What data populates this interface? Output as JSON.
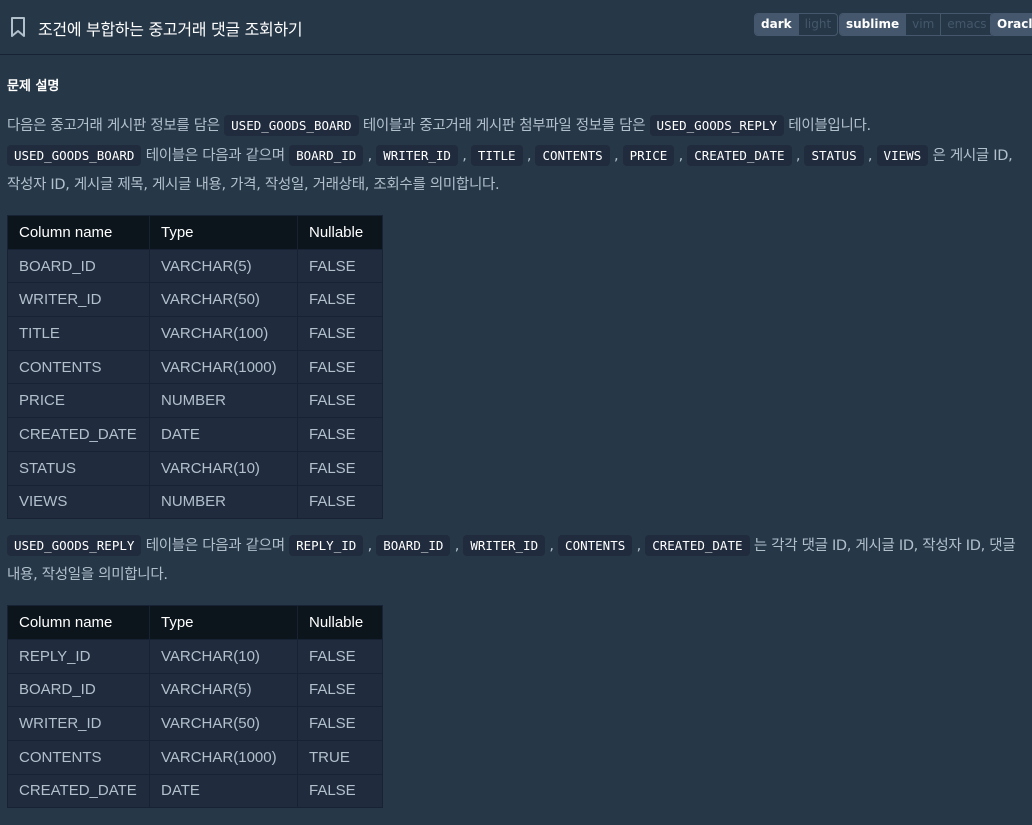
{
  "header": {
    "title": "조건에 부합하는 중고거래 댓글 조회하기",
    "theme_options": [
      "dark",
      "light"
    ],
    "theme_selected": "dark",
    "keymap_options": [
      "sublime",
      "vim",
      "emacs"
    ],
    "keymap_selected": "sublime",
    "language_selected": "Oracle"
  },
  "section_title": "문제 설명",
  "para1": {
    "t1": "다음은 중고거래 게시판 정보를 담은 ",
    "c1": "USED_GOODS_BOARD",
    "t2": " 테이블과 중고거래 게시판 첨부파일 정보를 담은 ",
    "c2": "USED_GOODS_REPLY",
    "t3": " 테이블입니다."
  },
  "para2": {
    "c0": "USED_GOODS_BOARD",
    "t0": " 테이블은 다음과 같으며 ",
    "cols": [
      "BOARD_ID",
      "WRITER_ID",
      "TITLE",
      "CONTENTS",
      "PRICE",
      "CREATED_DATE",
      "STATUS",
      "VIEWS"
    ],
    "sep": " , ",
    "t_end": " 은 게시글 ID, 작성자 ID, 게시글 제목, 게시글 내용, 가격, 작성일, 거래상태, 조회수를 의미합니다."
  },
  "table1": {
    "headers": [
      "Column name",
      "Type",
      "Nullable"
    ],
    "rows": [
      [
        "BOARD_ID",
        "VARCHAR(5)",
        "FALSE"
      ],
      [
        "WRITER_ID",
        "VARCHAR(50)",
        "FALSE"
      ],
      [
        "TITLE",
        "VARCHAR(100)",
        "FALSE"
      ],
      [
        "CONTENTS",
        "VARCHAR(1000)",
        "FALSE"
      ],
      [
        "PRICE",
        "NUMBER",
        "FALSE"
      ],
      [
        "CREATED_DATE",
        "DATE",
        "FALSE"
      ],
      [
        "STATUS",
        "VARCHAR(10)",
        "FALSE"
      ],
      [
        "VIEWS",
        "NUMBER",
        "FALSE"
      ]
    ]
  },
  "para3": {
    "c0": "USED_GOODS_REPLY",
    "t0": " 테이블은 다음과 같으며 ",
    "cols": [
      "REPLY_ID",
      "BOARD_ID",
      "WRITER_ID",
      "CONTENTS",
      "CREATED_DATE"
    ],
    "sep": " , ",
    "t_end": " 는 각각 댓글 ID, 게시글 ID, 작성자 ID, 댓글 내용, 작성일을 의미합니다."
  },
  "table2": {
    "headers": [
      "Column name",
      "Type",
      "Nullable"
    ],
    "rows": [
      [
        "REPLY_ID",
        "VARCHAR(10)",
        "FALSE"
      ],
      [
        "BOARD_ID",
        "VARCHAR(5)",
        "FALSE"
      ],
      [
        "WRITER_ID",
        "VARCHAR(50)",
        "FALSE"
      ],
      [
        "CONTENTS",
        "VARCHAR(1000)",
        "TRUE"
      ],
      [
        "CREATED_DATE",
        "DATE",
        "FALSE"
      ]
    ]
  },
  "colors": {
    "background": "#263747",
    "code_bg": "#202B3D",
    "table_header_bg": "#0C151C",
    "text": "#B2C0CC"
  },
  "icons": {
    "bookmark": "bookmark-icon"
  }
}
